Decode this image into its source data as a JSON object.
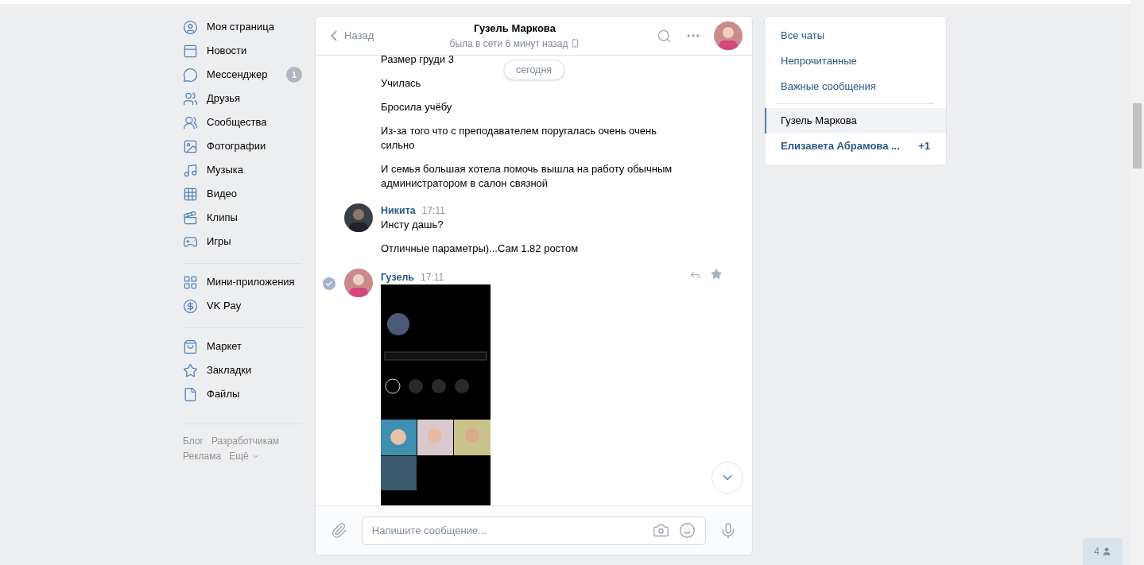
{
  "nav": {
    "groups": [
      [
        {
          "label": "Моя страница"
        },
        {
          "label": "Новости"
        },
        {
          "label": "Мессенджер",
          "badge": "1"
        },
        {
          "label": "Друзья"
        },
        {
          "label": "Сообщества"
        },
        {
          "label": "Фотографии"
        },
        {
          "label": "Музыка"
        },
        {
          "label": "Видео"
        },
        {
          "label": "Клипы"
        },
        {
          "label": "Игры"
        }
      ],
      [
        {
          "label": "Мини-приложения"
        },
        {
          "label": "VK Pay"
        }
      ],
      [
        {
          "label": "Маркет"
        },
        {
          "label": "Закладки"
        },
        {
          "label": "Файлы"
        }
      ]
    ],
    "footer_links": [
      "Блог",
      "Разработчикам",
      "Реклама",
      "Ещё"
    ]
  },
  "chat": {
    "header": {
      "back": "Назад",
      "name": "Гузель Маркова",
      "status": "была в сети 6 минут назад"
    },
    "date_chip": "сегодня",
    "messages": [
      {
        "selected": false,
        "texts": [
          "Размер груди 3",
          "Училась",
          "Бросила учёбу",
          "Из-за того что с преподавателем поругалась очень очень сильно",
          "И семья большая хотела помочь вышла на работу обычным администратором в салон связной"
        ]
      },
      {
        "selected": false,
        "author": "Никита",
        "time": "17:11",
        "texts": [
          "Инсту дашь?",
          "Отличные параметры)...Сам 1.82 ростом"
        ]
      },
      {
        "selected": true,
        "author": "Гузель",
        "time": "17:11"
      }
    ],
    "input": {
      "placeholder": "Напишите сообщение..."
    }
  },
  "filters": [
    {
      "label": "Все чаты",
      "selected": false
    },
    {
      "label": "Непрочитанные",
      "selected": false
    },
    {
      "label": "Важные сообщения",
      "selected": false
    }
  ],
  "chats": [
    {
      "name": "Гузель Маркова",
      "selected": true
    },
    {
      "name": "Елизавета Абрамова ...",
      "selected": false,
      "count": "+1"
    }
  ],
  "online_badge": "4"
}
